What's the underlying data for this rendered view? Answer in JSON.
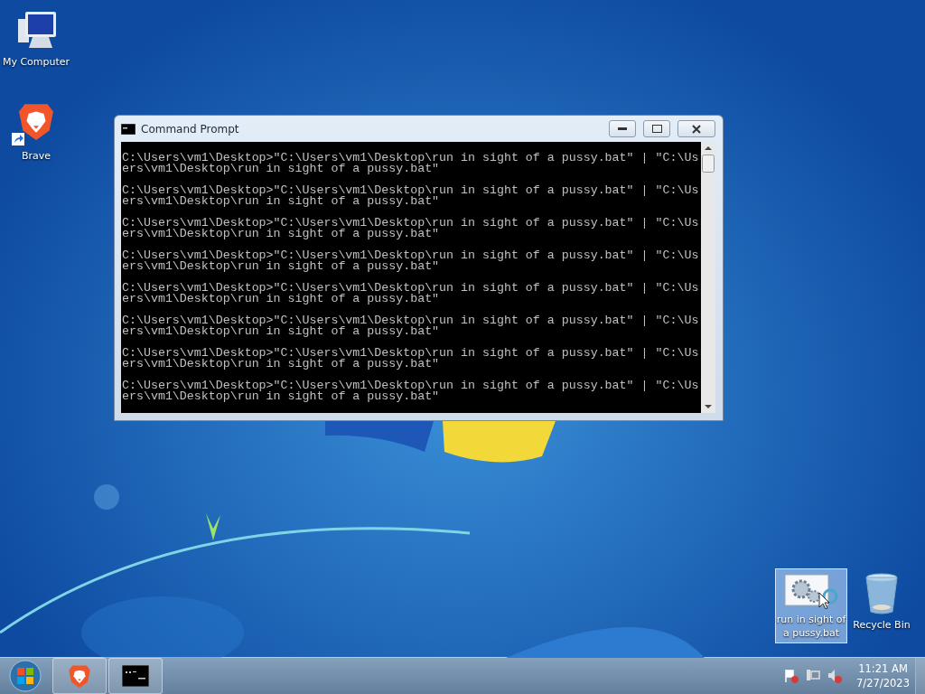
{
  "desktop_icons": [
    {
      "kind": "computer",
      "label": "My Computer",
      "selected": false
    },
    {
      "kind": "brave",
      "label": "Brave",
      "selected": false
    },
    {
      "kind": "batch",
      "label": "run in sight of a pussy.bat",
      "selected": true
    },
    {
      "kind": "recycle",
      "label": "Recycle Bin",
      "selected": false
    }
  ],
  "window": {
    "title": "Command Prompt",
    "entries": [
      [
        "C:\\Users\\vm1\\Desktop>\"C:\\Users\\vm1\\Desktop\\run in sight of a pussy.bat\" | \"C:\\Us",
        "ers\\vm1\\Desktop\\run in sight of a pussy.bat\""
      ],
      [
        "C:\\Users\\vm1\\Desktop>\"C:\\Users\\vm1\\Desktop\\run in sight of a pussy.bat\" | \"C:\\Us",
        "ers\\vm1\\Desktop\\run in sight of a pussy.bat\""
      ],
      [
        "C:\\Users\\vm1\\Desktop>\"C:\\Users\\vm1\\Desktop\\run in sight of a pussy.bat\" | \"C:\\Us",
        "ers\\vm1\\Desktop\\run in sight of a pussy.bat\""
      ],
      [
        "C:\\Users\\vm1\\Desktop>\"C:\\Users\\vm1\\Desktop\\run in sight of a pussy.bat\" | \"C:\\Us",
        "ers\\vm1\\Desktop\\run in sight of a pussy.bat\""
      ],
      [
        "C:\\Users\\vm1\\Desktop>\"C:\\Users\\vm1\\Desktop\\run in sight of a pussy.bat\" | \"C:\\Us",
        "ers\\vm1\\Desktop\\run in sight of a pussy.bat\""
      ],
      [
        "C:\\Users\\vm1\\Desktop>\"C:\\Users\\vm1\\Desktop\\run in sight of a pussy.bat\" | \"C:\\Us",
        "ers\\vm1\\Desktop\\run in sight of a pussy.bat\""
      ],
      [
        "C:\\Users\\vm1\\Desktop>\"C:\\Users\\vm1\\Desktop\\run in sight of a pussy.bat\" | \"C:\\Us",
        "ers\\vm1\\Desktop\\run in sight of a pussy.bat\""
      ],
      [
        "C:\\Users\\vm1\\Desktop>\"C:\\Users\\vm1\\Desktop\\run in sight of a pussy.bat\" | \"C:\\Us",
        "ers\\vm1\\Desktop\\run in sight of a pussy.bat\""
      ]
    ]
  },
  "taskbar": {
    "items": [
      {
        "kind": "start"
      },
      {
        "kind": "brave"
      },
      {
        "kind": "console"
      }
    ],
    "tray": {
      "time": "11:21 AM",
      "date": "7/27/2023"
    }
  }
}
